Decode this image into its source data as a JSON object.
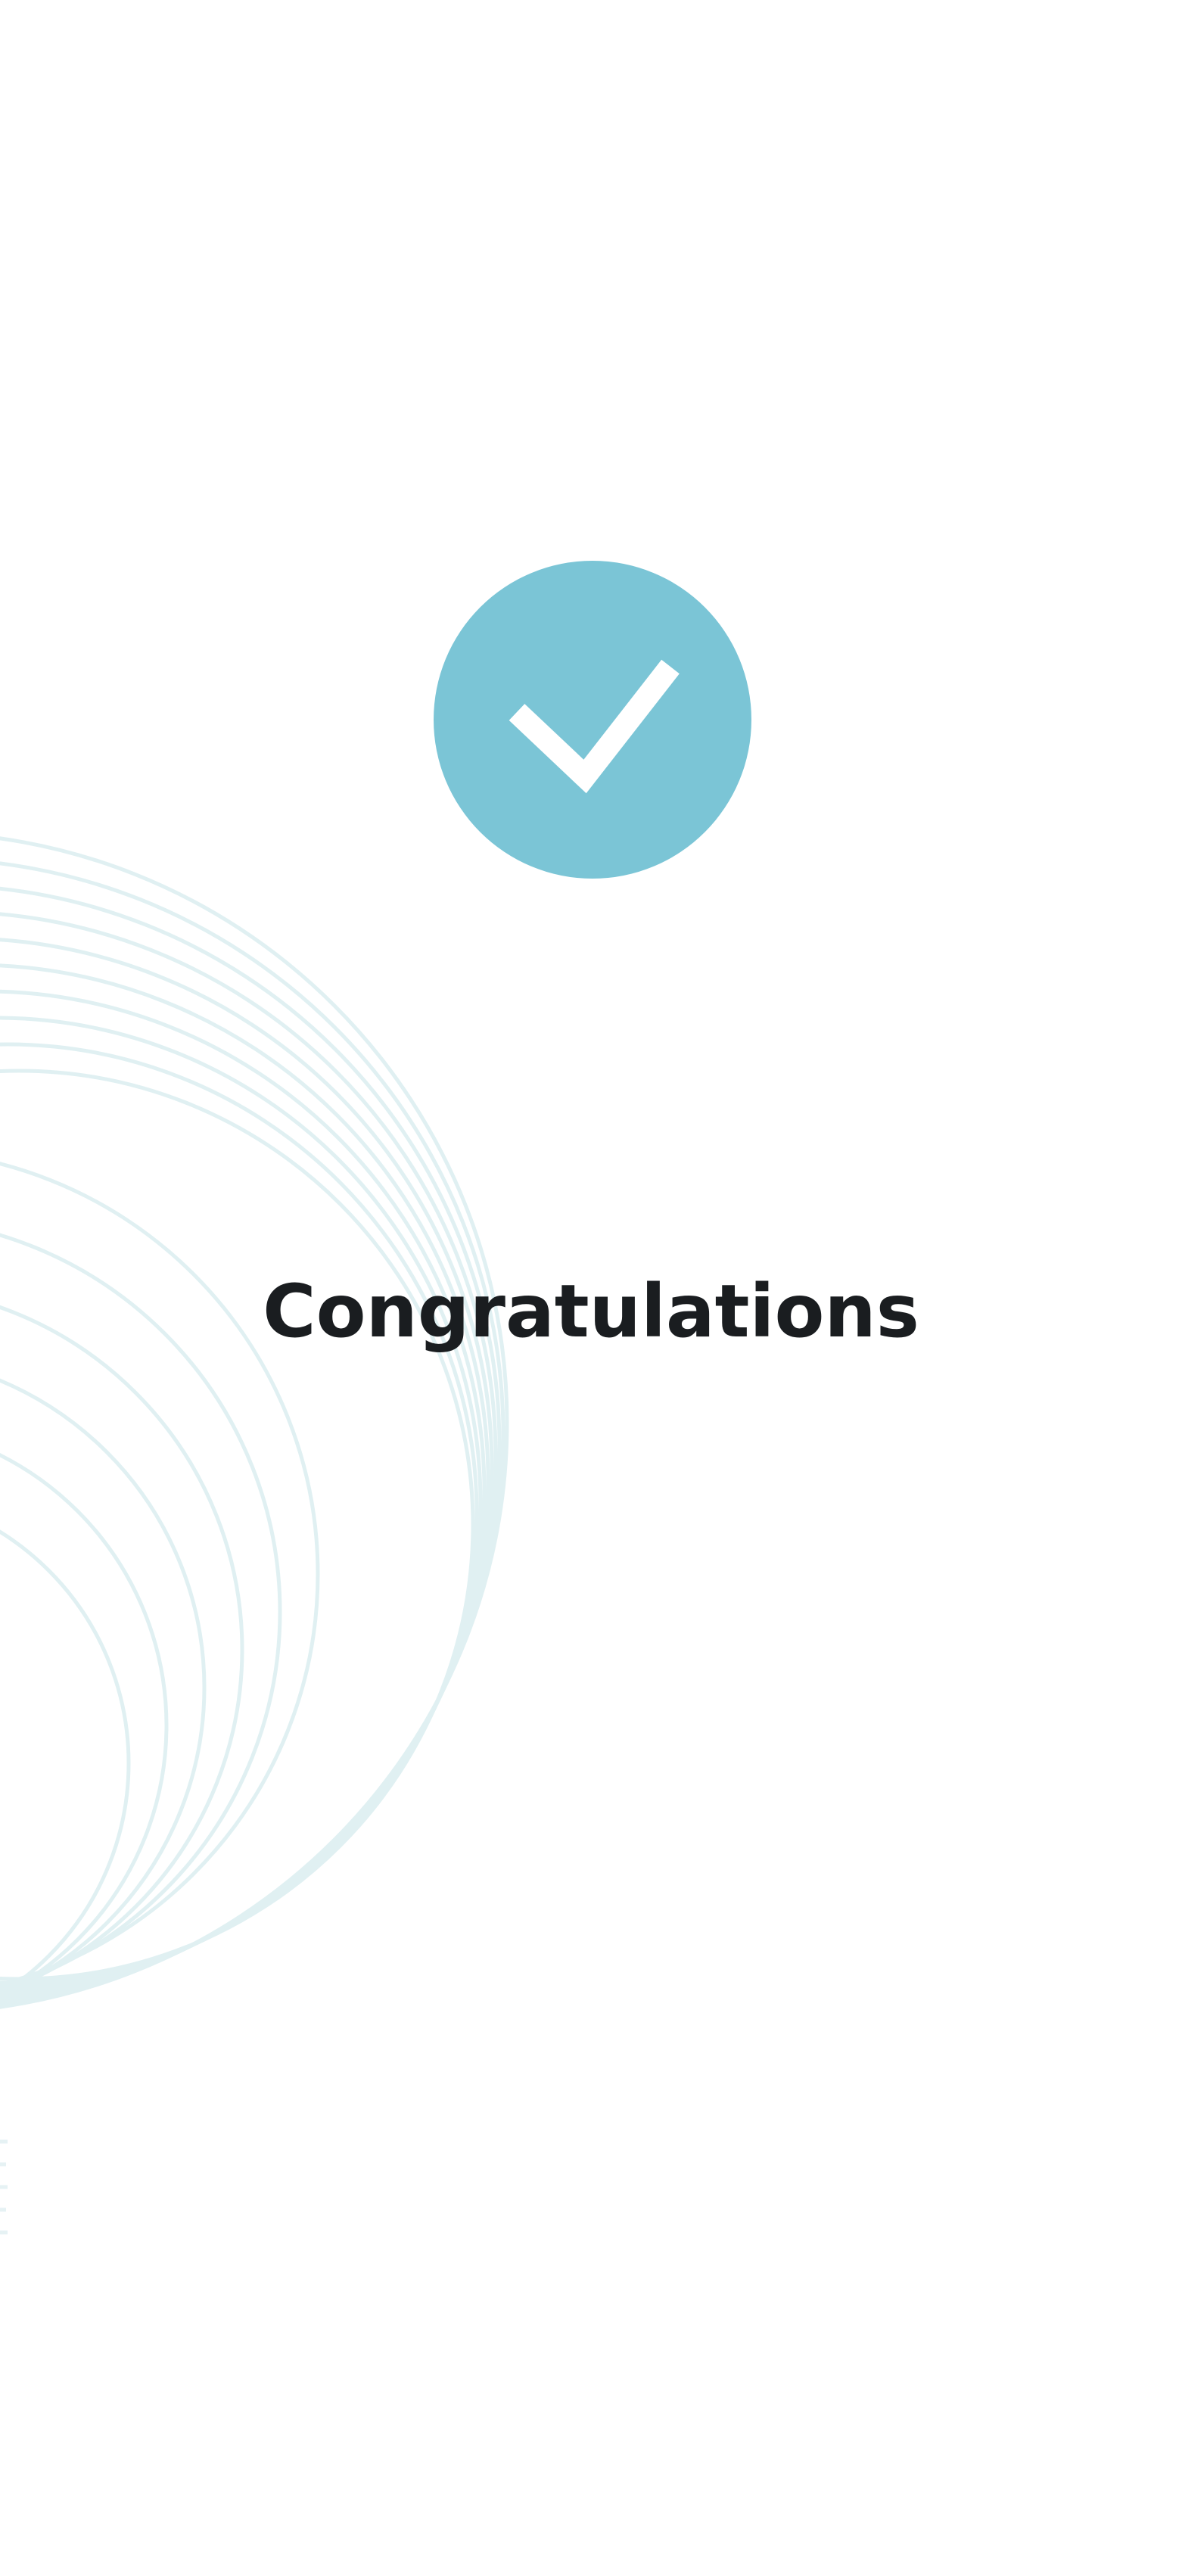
{
  "screen": {
    "title": "Congratulations",
    "status_icon": "checkmark-icon"
  },
  "colors": {
    "background": "#ffffff",
    "badge": "#7bc5d6",
    "check": "#ffffff",
    "title": "#1a1d20",
    "rings": "#d6ebee"
  }
}
